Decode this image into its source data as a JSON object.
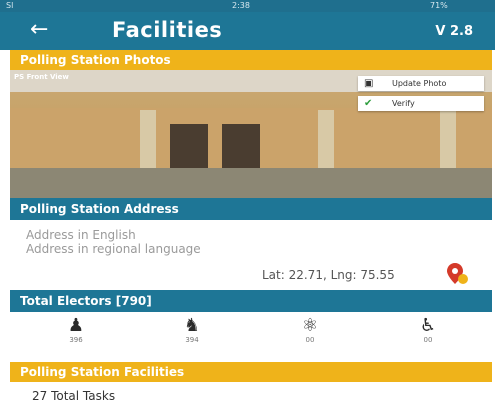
{
  "status_bar": {
    "left": "Sl",
    "time": "2:38",
    "right": "71%"
  },
  "app_bar": {
    "back_icon": "back-arrow-icon",
    "title": "Facilities",
    "version": "V 2.8"
  },
  "photos_section": {
    "title": "Polling Station Photos",
    "photo_caption": "PS Front View",
    "update_label": "Update Photo",
    "verify_label": "Verify",
    "current_slide": 1,
    "slide_count": 2
  },
  "address_section": {
    "title": "Polling Station Address",
    "english_placeholder": "Address in English",
    "regional_placeholder": "Address in regional language",
    "latlng": "Lat: 22.71, Lng: 75.55"
  },
  "electors_section": {
    "title": "Total Electors [790]",
    "items": [
      {
        "icon": "male-voter-icon",
        "count": "396"
      },
      {
        "icon": "female-voter-icon",
        "count": "394"
      },
      {
        "icon": "third-gender-icon",
        "count": "00"
      },
      {
        "icon": "disabled-voter-icon",
        "count": "00"
      }
    ]
  },
  "facilities_section": {
    "title": "Polling Station Facilities",
    "tasks": "27 Total Tasks"
  },
  "colors": {
    "primary": "#1e7696",
    "accent": "#efb31a"
  }
}
